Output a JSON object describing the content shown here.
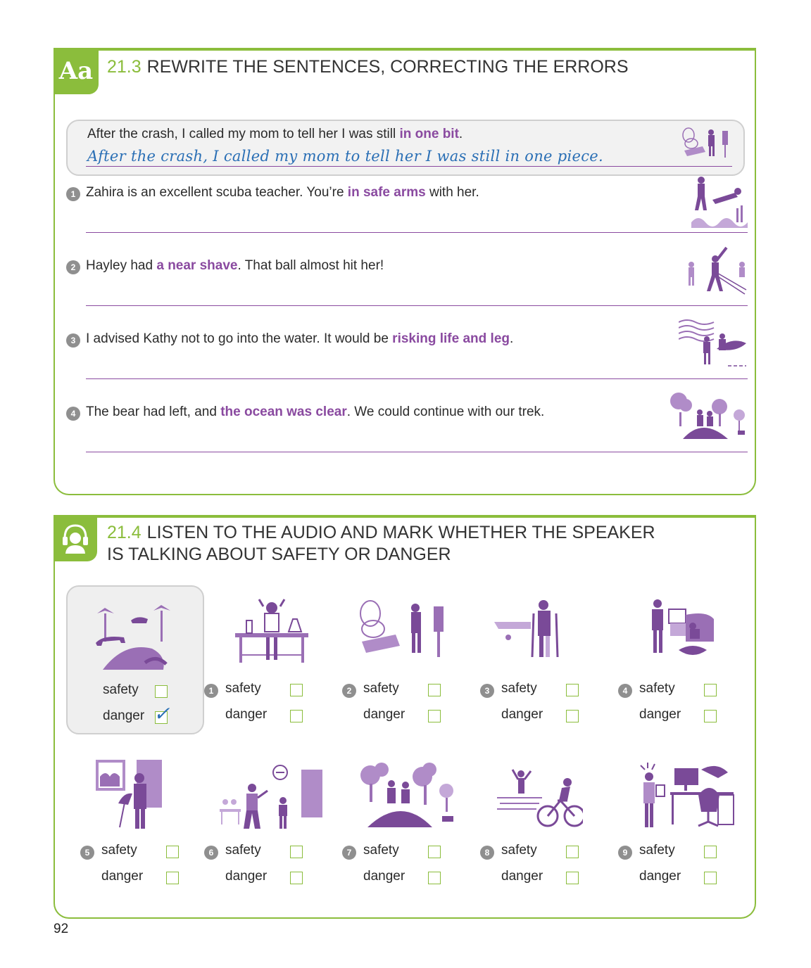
{
  "section1": {
    "tab_label": "Aa",
    "number": "21.3",
    "title": "REWRITE THE SENTENCES, CORRECTING THE ERRORS",
    "example": {
      "before": "After the crash, I called my mom to tell her I was still ",
      "highlight": "in one bit",
      "after": ".",
      "answer": "After the crash, I called my mom to tell her I was still in one piece."
    },
    "items": [
      {
        "num": "1",
        "before": "Zahira is an excellent scuba teacher. You’re ",
        "highlight": "in safe arms",
        "after": " with her."
      },
      {
        "num": "2",
        "before": "Hayley had ",
        "highlight": "a near shave",
        "after": ". That ball almost hit her!"
      },
      {
        "num": "3",
        "before": "I advised Kathy not to go into the water. It would be ",
        "highlight": "risking life and leg",
        "after": "."
      },
      {
        "num": "4",
        "before": "The bear had left, and ",
        "highlight": "the ocean was clear",
        "after": ". We could continue with our trek."
      }
    ]
  },
  "section2": {
    "number": "21.4",
    "title_line1": "LISTEN TO THE AUDIO AND MARK WHETHER THE SPEAKER",
    "title_line2": "IS TALKING ABOUT SAFETY OR DANGER",
    "example": {
      "safety": "safety",
      "danger": "danger",
      "checked": "danger"
    },
    "items": [
      {
        "num": "1",
        "safety": "safety",
        "danger": "danger"
      },
      {
        "num": "2",
        "safety": "safety",
        "danger": "danger"
      },
      {
        "num": "3",
        "safety": "safety",
        "danger": "danger"
      },
      {
        "num": "4",
        "safety": "safety",
        "danger": "danger"
      },
      {
        "num": "5",
        "safety": "safety",
        "danger": "danger"
      },
      {
        "num": "6",
        "safety": "safety",
        "danger": "danger"
      },
      {
        "num": "7",
        "safety": "safety",
        "danger": "danger"
      },
      {
        "num": "8",
        "safety": "safety",
        "danger": "danger"
      },
      {
        "num": "9",
        "safety": "safety",
        "danger": "danger"
      }
    ]
  },
  "page_number": "92",
  "colors": {
    "accent_green": "#8bbd3c",
    "highlight_purple": "#8a4aa0",
    "handwriting_blue": "#2a6fb5",
    "illustration_purple": "#9a6fb5"
  },
  "icons": [
    "headphones-icon",
    "car-crash-illustration",
    "scuba-illustration",
    "baseball-illustration",
    "surfer-illustration",
    "hikers-illustration",
    "jungle-tiger-illustration",
    "scientist-illustration",
    "crutches-illustration",
    "stolen-laptop-illustration",
    "umbrella-window-illustration",
    "child-door-illustration",
    "swimmer-cyclist-illustration",
    "office-worker-illustration"
  ]
}
